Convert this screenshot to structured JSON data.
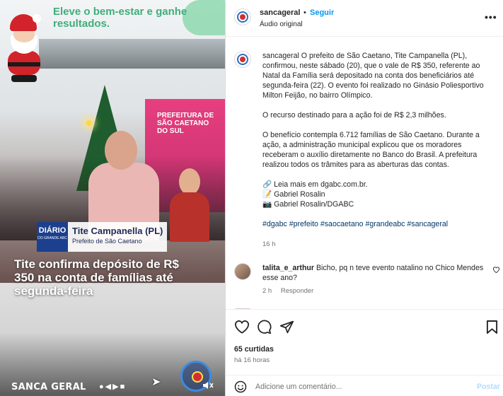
{
  "video": {
    "banner_text": "Eleve o bem-estar e ganhe resultados.",
    "panel_logo": "PREFEITURA DE SÃO CAETANO DO SUL",
    "lower_third": {
      "logo_main": "DIÁRIO",
      "logo_sub": "DO GRANDE ABC",
      "name": "Tite Campanella (PL)",
      "role": "Prefeito de São Caetano"
    },
    "headline": "Tite confirma depósito de R$ 350 na conta de famílias até segunda-feira",
    "brand": "SANCA GERAL",
    "brand_social": "●◀▶■",
    "watermark_text": "DIÁRIO"
  },
  "post": {
    "username": "sancageral",
    "separator": "•",
    "follow_label": "Seguir",
    "audio": "Áudio original",
    "more_icon": "•••",
    "caption": {
      "user": "sancageral",
      "p1": "O prefeito de São Caetano, Tite Campanella (PL), confirmou, neste sábado (20), que o vale de R$ 350, referente ao Natal da Família será depositado na conta dos beneficiários até segunda-feira (22). O evento foi realizado no Ginásio Poliesportivo Milton Feijão, no bairro Olímpico.",
      "p2": "O recurso destinado para a ação foi de R$ 2,3 milhões.",
      "p3": "O benefício contempla 6.712 famílias de São Caetano. Durante a ação, a administração municipal explicou que os moradores receberam o auxílio diretamente no Banco do Brasil. A prefeitura realizou todos os trâmites para as aberturas das contas.",
      "link_line": "🔗 Leia mais em dgabc.com.br.",
      "credit1": "📝 Gabriel Rosalin",
      "credit2": "📷 Gabriel Rosalin/DGABC",
      "tags": "#dgabc #prefeito #saocaetano #grandeabc #sancageral",
      "time": "16 h"
    },
    "comment": {
      "user": "talita_e_arthur",
      "text": "Bicho, pq n teve evento natalino no Chico Mendes esse ano?",
      "time": "2 h",
      "reply_label": "Responder"
    },
    "likes": "65 curtidas",
    "posted_ago": "há 16 horas",
    "comment_placeholder": "Adicione um comentário...",
    "post_label": "Postar"
  }
}
